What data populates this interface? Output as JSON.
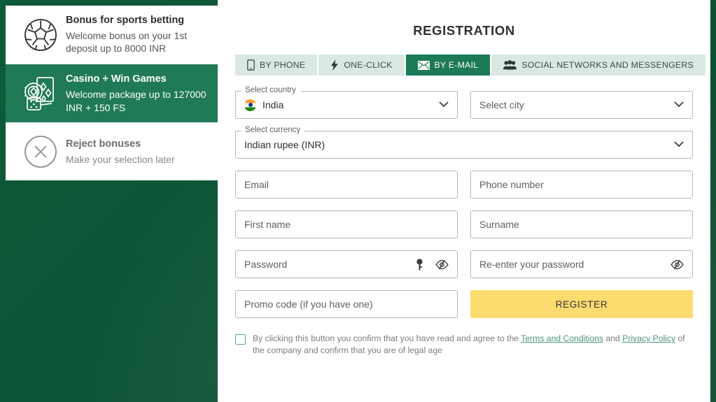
{
  "theme": {
    "background_green": "#0d5436",
    "selected_card_green": "#1f7a55",
    "active_tab_green": "#1d7a56",
    "tab_bar_mint": "#d9e9e1",
    "register_yellow": "#fcdb6f",
    "link_green": "#4a9478"
  },
  "sidebar": {
    "items": [
      {
        "icon": "soccer-ball-icon",
        "title": "Bonus for sports betting",
        "description": "Welcome bonus on your 1st deposit up to 8000 INR",
        "state": "default"
      },
      {
        "icon": "casino-cards-chip-dice-icon",
        "title": "Casino + Win Games",
        "description": "Welcome package up to 127000 INR + 150 FS",
        "state": "selected"
      },
      {
        "icon": "circle-x-icon",
        "title": "Reject bonuses",
        "description": "Make your selection later",
        "state": "muted"
      }
    ]
  },
  "panel": {
    "title": "REGISTRATION",
    "tabs": [
      {
        "label": "BY PHONE",
        "icon": "mobile-phone-icon",
        "active": false
      },
      {
        "label": "ONE-CLICK",
        "icon": "lightning-bolt-icon",
        "active": false
      },
      {
        "label": "BY E-MAIL",
        "icon": "envelope-icon",
        "active": true
      },
      {
        "label": "SOCIAL NETWORKS AND MESSENGERS",
        "icon": "people-group-icon",
        "active": false
      }
    ],
    "form": {
      "country": {
        "label": "Select country",
        "value": "India",
        "flag": "india-flag-icon"
      },
      "city": {
        "placeholder": "Select city"
      },
      "currency": {
        "label": "Select currency",
        "value": "Indian rupee (INR)"
      },
      "email": {
        "placeholder": "Email",
        "value": ""
      },
      "phone": {
        "placeholder": "Phone number",
        "value": ""
      },
      "first_name": {
        "placeholder": "First name",
        "value": ""
      },
      "surname": {
        "placeholder": "Surname",
        "value": ""
      },
      "password": {
        "placeholder": "Password",
        "value": "",
        "icons": [
          "key-icon",
          "eye-off-icon"
        ]
      },
      "password_repeat": {
        "placeholder": "Re-enter your password",
        "value": "",
        "icons": [
          "eye-off-icon"
        ]
      },
      "promo": {
        "placeholder": "Promo code (if you have one)",
        "value": ""
      },
      "register_label": "REGISTER"
    },
    "terms": {
      "checked": false,
      "text_before": "By clicking this button you confirm that you have read and agree to the ",
      "link_terms": "Terms and Conditions",
      "text_middle": " and ",
      "link_privacy": "Privacy Policy",
      "text_after": " of the company and confirm that you are of legal age"
    }
  }
}
